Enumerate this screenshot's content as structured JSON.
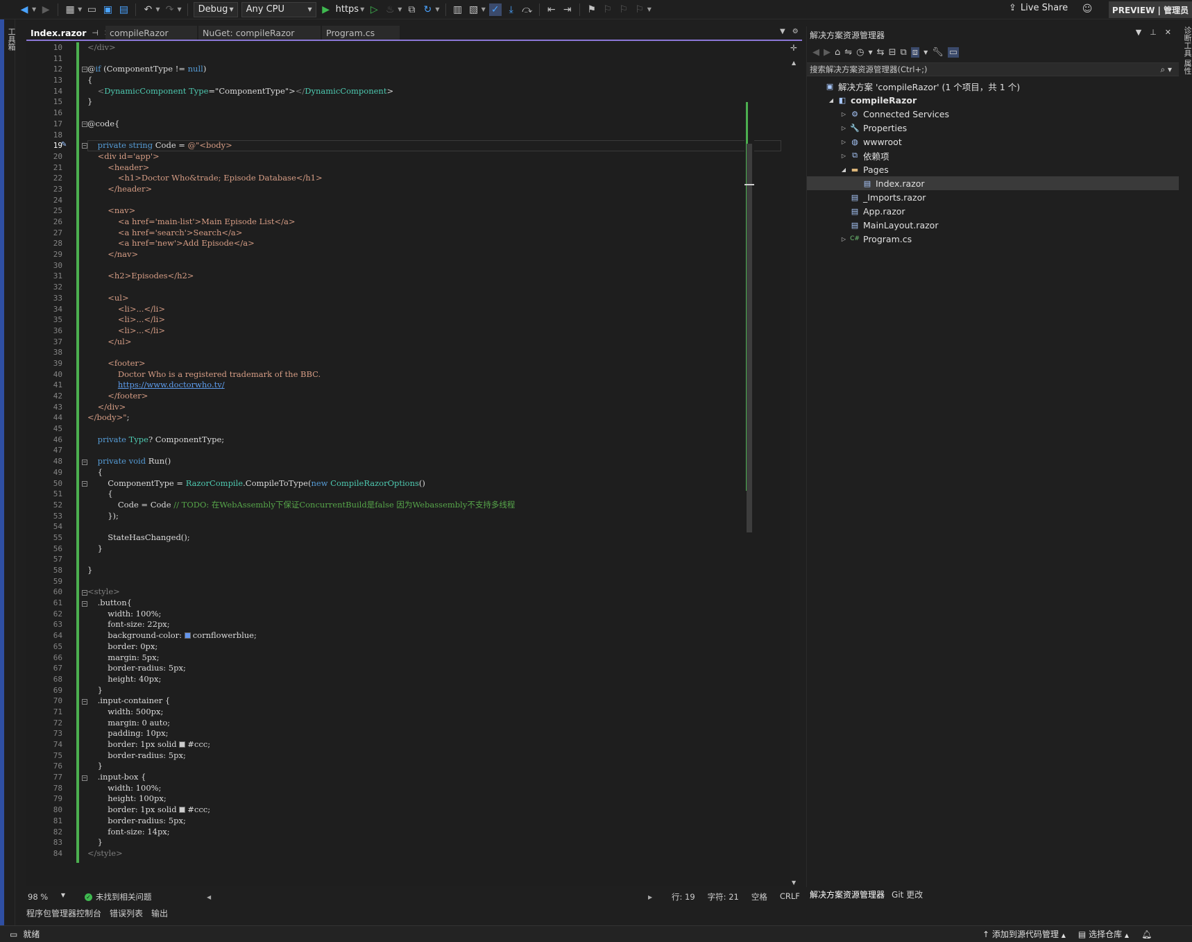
{
  "toolbar": {
    "config": "Debug",
    "platform": "Any CPU",
    "run_target": "https",
    "live_share": "Live Share",
    "preview_badge": "PREVIEW | 管理员"
  },
  "side_strips": {
    "left": "工具箱",
    "right": "诊断工具 属性"
  },
  "tabs": [
    {
      "label": "Index.razor",
      "active": true
    },
    {
      "label": "compileRazor",
      "active": false
    },
    {
      "label": "NuGet: compileRazor",
      "active": false
    },
    {
      "label": "Program.cs",
      "active": false
    }
  ],
  "editor": {
    "current_line": 19,
    "lines": [
      {
        "n": 10,
        "t": "</div>"
      },
      {
        "n": 11,
        "t": ""
      },
      {
        "n": 12,
        "t": "@if (ComponentType != null)"
      },
      {
        "n": 13,
        "t": "{"
      },
      {
        "n": 14,
        "t": "    <DynamicComponent Type=\"ComponentType\"></DynamicComponent>"
      },
      {
        "n": 15,
        "t": "}"
      },
      {
        "n": 16,
        "t": ""
      },
      {
        "n": 17,
        "t": "@code{"
      },
      {
        "n": 18,
        "t": ""
      },
      {
        "n": 19,
        "t": "    private string Code = @\"<body>"
      },
      {
        "n": 20,
        "t": "    <div id='app'>"
      },
      {
        "n": 21,
        "t": "        <header>"
      },
      {
        "n": 22,
        "t": "            <h1>Doctor Who&trade; Episode Database</h1>"
      },
      {
        "n": 23,
        "t": "        </header>"
      },
      {
        "n": 24,
        "t": ""
      },
      {
        "n": 25,
        "t": "        <nav>"
      },
      {
        "n": 26,
        "t": "            <a href='main-list'>Main Episode List</a>"
      },
      {
        "n": 27,
        "t": "            <a href='search'>Search</a>"
      },
      {
        "n": 28,
        "t": "            <a href='new'>Add Episode</a>"
      },
      {
        "n": 29,
        "t": "        </nav>"
      },
      {
        "n": 30,
        "t": ""
      },
      {
        "n": 31,
        "t": "        <h2>Episodes</h2>"
      },
      {
        "n": 32,
        "t": ""
      },
      {
        "n": 33,
        "t": "        <ul>"
      },
      {
        "n": 34,
        "t": "            <li>...</li>"
      },
      {
        "n": 35,
        "t": "            <li>...</li>"
      },
      {
        "n": 36,
        "t": "            <li>...</li>"
      },
      {
        "n": 37,
        "t": "        </ul>"
      },
      {
        "n": 38,
        "t": ""
      },
      {
        "n": 39,
        "t": "        <footer>"
      },
      {
        "n": 40,
        "t": "            Doctor Who is a registered trademark of the BBC."
      },
      {
        "n": 41,
        "t": "            https://www.doctorwho.tv/"
      },
      {
        "n": 42,
        "t": "        </footer>"
      },
      {
        "n": 43,
        "t": "    </div>"
      },
      {
        "n": 44,
        "t": "</body>\";"
      },
      {
        "n": 45,
        "t": ""
      },
      {
        "n": 46,
        "t": "    private Type? ComponentType;"
      },
      {
        "n": 47,
        "t": ""
      },
      {
        "n": 48,
        "t": "    private void Run()"
      },
      {
        "n": 49,
        "t": "    {"
      },
      {
        "n": 50,
        "t": "        ComponentType = RazorCompile.CompileToType(new CompileRazorOptions()"
      },
      {
        "n": 51,
        "t": "        {"
      },
      {
        "n": 52,
        "t": "            Code = Code // TODO: 在WebAssembly下保证ConcurrentBuild是false 因为Webassembly不支持多线程"
      },
      {
        "n": 53,
        "t": "        });"
      },
      {
        "n": 54,
        "t": ""
      },
      {
        "n": 55,
        "t": "        StateHasChanged();"
      },
      {
        "n": 56,
        "t": "    }"
      },
      {
        "n": 57,
        "t": ""
      },
      {
        "n": 58,
        "t": "}"
      },
      {
        "n": 59,
        "t": ""
      },
      {
        "n": 60,
        "t": "<style>"
      },
      {
        "n": 61,
        "t": "    .button{"
      },
      {
        "n": 62,
        "t": "        width: 100%;"
      },
      {
        "n": 63,
        "t": "        font-size: 22px;"
      },
      {
        "n": 64,
        "t": "        background-color: cornflowerblue;"
      },
      {
        "n": 65,
        "t": "        border: 0px;"
      },
      {
        "n": 66,
        "t": "        margin: 5px;"
      },
      {
        "n": 67,
        "t": "        border-radius: 5px;"
      },
      {
        "n": 68,
        "t": "        height: 40px;"
      },
      {
        "n": 69,
        "t": "    }"
      },
      {
        "n": 70,
        "t": "    .input-container {"
      },
      {
        "n": 71,
        "t": "        width: 500px;"
      },
      {
        "n": 72,
        "t": "        margin: 0 auto;"
      },
      {
        "n": 73,
        "t": "        padding: 10px;"
      },
      {
        "n": 74,
        "t": "        border: 1px solid #ccc;"
      },
      {
        "n": 75,
        "t": "        border-radius: 5px;"
      },
      {
        "n": 76,
        "t": "    }"
      },
      {
        "n": 77,
        "t": "    .input-box {"
      },
      {
        "n": 78,
        "t": "        width: 100%;"
      },
      {
        "n": 79,
        "t": "        height: 100px;"
      },
      {
        "n": 80,
        "t": "        border: 1px solid #ccc;"
      },
      {
        "n": 81,
        "t": "        border-radius: 5px;"
      },
      {
        "n": 82,
        "t": "        font-size: 14px;"
      },
      {
        "n": 83,
        "t": "    }"
      },
      {
        "n": 84,
        "t": "</style>"
      }
    ]
  },
  "editor_status": {
    "zoom": "98 %",
    "issues": "未找到相关问题",
    "line": "行: 19",
    "col": "字符: 21",
    "whitespace": "空格",
    "eol": "CRLF"
  },
  "bottom_tabs": [
    "程序包管理器控制台",
    "错误列表",
    "输出"
  ],
  "statusbar": {
    "ready": "就绪",
    "source_control": "添加到源代码管理",
    "repo": "选择仓库"
  },
  "solution_explorer": {
    "title": "解决方案资源管理器",
    "search_placeholder": "搜索解决方案资源管理器(Ctrl+;)",
    "tree": [
      {
        "label": "解决方案 'compileRazor' (1 个项目，共 1 个)",
        "indent": 0,
        "arrow": "",
        "icon": "solution-icon",
        "glyph": "▣",
        "bold": false,
        "selected": false
      },
      {
        "label": "compileRazor",
        "indent": 1,
        "arrow": "◢",
        "icon": "project-icon",
        "glyph": "◧",
        "bold": true,
        "selected": false
      },
      {
        "label": "Connected Services",
        "indent": 2,
        "arrow": "▷",
        "icon": "connected-services-icon",
        "glyph": "⚙",
        "bold": false,
        "selected": false
      },
      {
        "label": "Properties",
        "indent": 2,
        "arrow": "▷",
        "icon": "properties-icon",
        "glyph": "🔧",
        "bold": false,
        "selected": false
      },
      {
        "label": "wwwroot",
        "indent": 2,
        "arrow": "▷",
        "icon": "globe-icon",
        "glyph": "◍",
        "bold": false,
        "selected": false
      },
      {
        "label": "依赖项",
        "indent": 2,
        "arrow": "▷",
        "icon": "dependencies-icon",
        "glyph": "⧉",
        "bold": false,
        "selected": false
      },
      {
        "label": "Pages",
        "indent": 2,
        "arrow": "◢",
        "icon": "folder-icon",
        "glyph": "▬",
        "bold": false,
        "selected": false
      },
      {
        "label": "Index.razor",
        "indent": 3,
        "arrow": "",
        "icon": "razor-file-icon",
        "glyph": "▤",
        "bold": false,
        "selected": true
      },
      {
        "label": "_Imports.razor",
        "indent": 2,
        "arrow": "",
        "icon": "razor-file-icon",
        "glyph": "▤",
        "bold": false,
        "selected": false
      },
      {
        "label": "App.razor",
        "indent": 2,
        "arrow": "",
        "icon": "razor-file-icon",
        "glyph": "▤",
        "bold": false,
        "selected": false
      },
      {
        "label": "MainLayout.razor",
        "indent": 2,
        "arrow": "",
        "icon": "razor-file-icon",
        "glyph": "▤",
        "bold": false,
        "selected": false
      },
      {
        "label": "Program.cs",
        "indent": 2,
        "arrow": "▷",
        "icon": "csharp-file-icon",
        "glyph": "C#",
        "bold": false,
        "selected": false
      }
    ],
    "bottom_tabs": [
      "解决方案资源管理器",
      "Git 更改"
    ]
  },
  "colors": {
    "accent": "#8c78d8",
    "change_bar": "#4caf50",
    "cornflowerblue": "#6495ed",
    "ccc": "#cccccc"
  }
}
